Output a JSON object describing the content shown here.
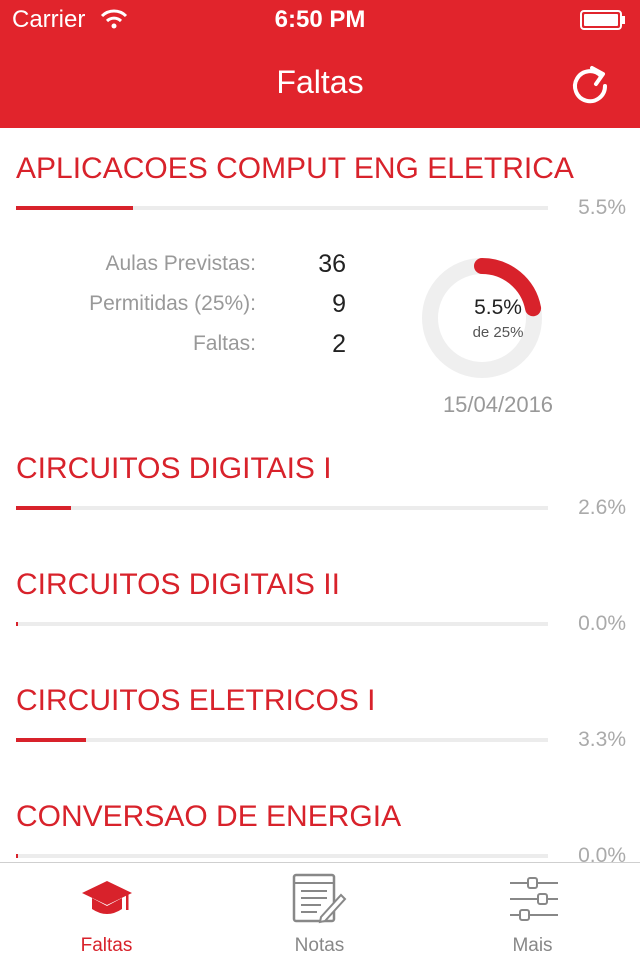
{
  "status_bar": {
    "carrier": "Carrier",
    "time": "6:50 PM"
  },
  "nav": {
    "title": "Faltas",
    "refresh_icon": "refresh-icon"
  },
  "courses": [
    {
      "name": "APLICACOES COMPUT ENG ELETRICA",
      "percent": "5.5%",
      "progress": 0.22,
      "details": {
        "aulas_label": "Aulas Previstas:",
        "aulas_value": "36",
        "permitidas_label": "Permitidas (25%):",
        "permitidas_value": "9",
        "faltas_label": "Faltas:",
        "faltas_value": "2",
        "donut_percent": "5.5%",
        "donut_sub": "de 25%",
        "donut_fraction": 0.22,
        "date": "15/04/2016"
      }
    },
    {
      "name": "CIRCUITOS DIGITAIS I",
      "percent": "2.6%",
      "progress": 0.104
    },
    {
      "name": "CIRCUITOS DIGITAIS II",
      "percent": "0.0%",
      "progress": 0.0
    },
    {
      "name": "CIRCUITOS ELETRICOS I",
      "percent": "3.3%",
      "progress": 0.132
    },
    {
      "name": "CONVERSAO DE ENERGIA",
      "percent": "0.0%",
      "progress": 0.0
    }
  ],
  "tabs": [
    {
      "label": "Faltas",
      "icon": "graduation-cap-icon",
      "active": true
    },
    {
      "label": "Notas",
      "icon": "notebook-pencil-icon",
      "active": false
    },
    {
      "label": "Mais",
      "icon": "sliders-icon",
      "active": false
    }
  ],
  "colors": {
    "accent": "#e1242c",
    "track": "#ececec",
    "muted": "#999999"
  }
}
